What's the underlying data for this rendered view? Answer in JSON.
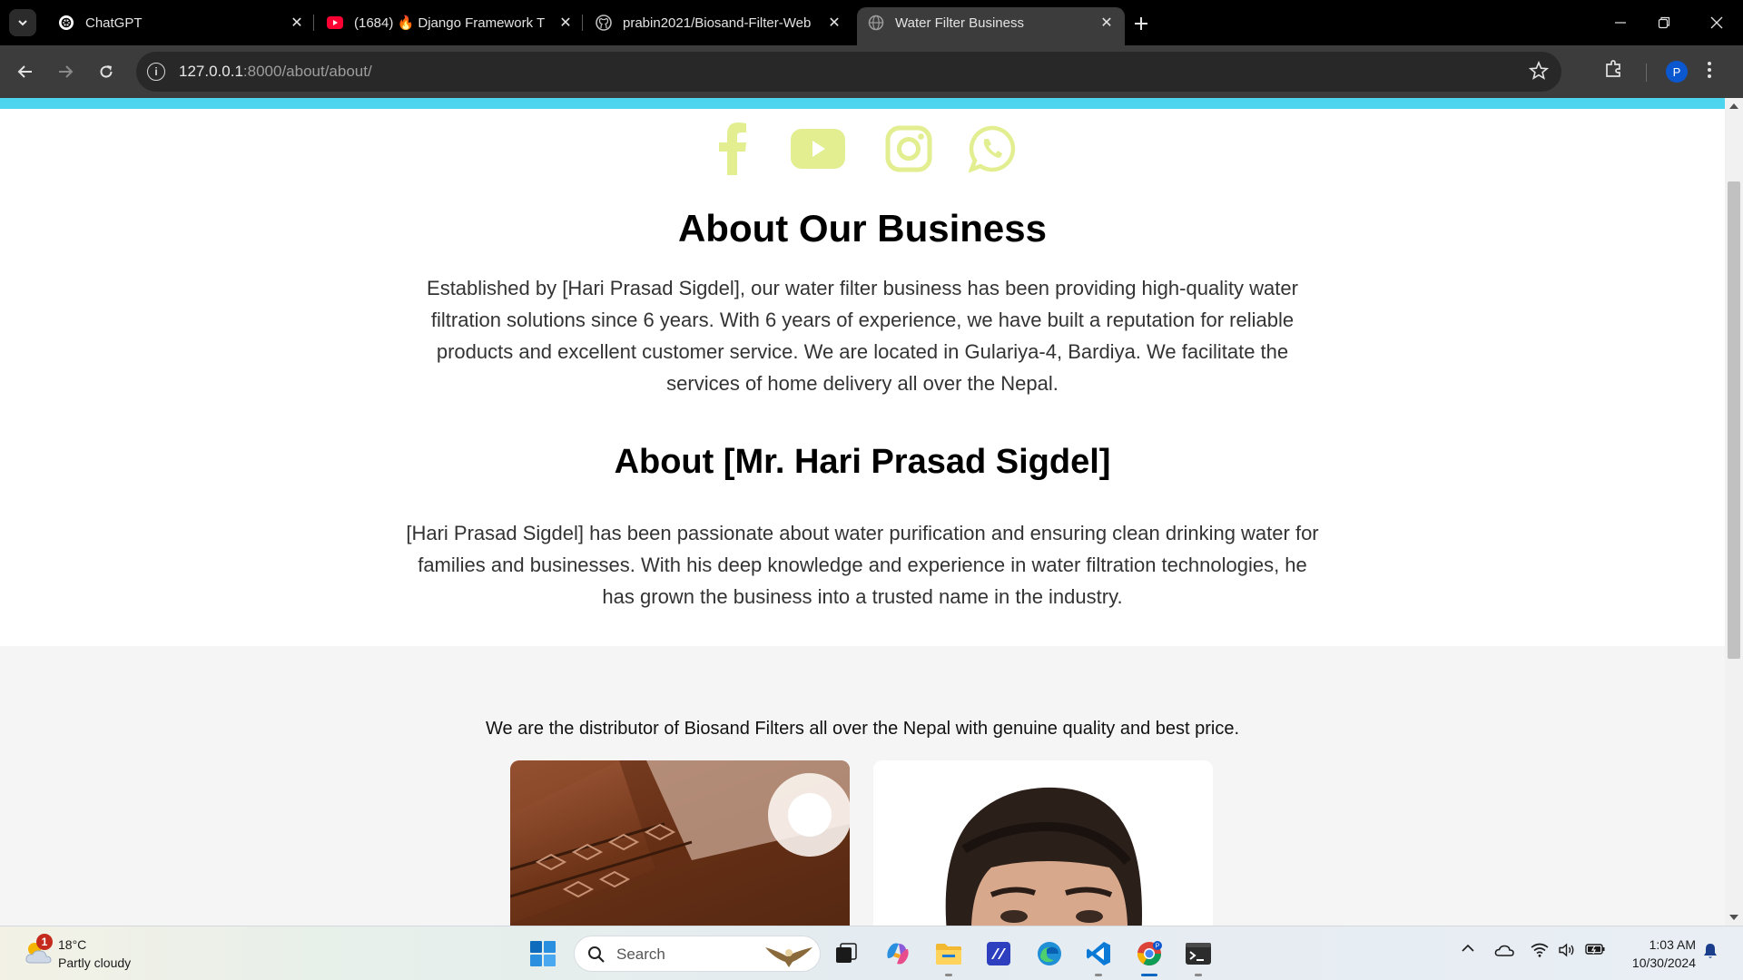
{
  "browser": {
    "tabs": [
      {
        "title": "ChatGPT",
        "icon": "chatgpt-icon",
        "active": false
      },
      {
        "title": "(1684) 🔥 Django Framework T",
        "icon": "youtube-icon",
        "active": false
      },
      {
        "title": "prabin2021/Biosand-Filter-Web",
        "icon": "github-icon",
        "active": false
      },
      {
        "title": "Water Filter Business",
        "icon": "globe-icon",
        "active": true
      }
    ],
    "url_host": "127.0.0.1",
    "url_rest": ":8000/about/about/",
    "profile_initial": "P"
  },
  "page": {
    "accent_color": "#4dd4ee",
    "social_color": "#e2ee8f",
    "social_icons": [
      "facebook-icon",
      "youtube-icon",
      "instagram-icon",
      "whatsapp-icon"
    ],
    "about_title": "About Our Business",
    "about_text": "Established by [Hari Prasad Sigdel], our water filter business has been providing high-quality water filtration solutions since 6 years. With 6 years of experience, we have built a reputation for reliable products and excellent customer service. We are located in Gulariya-4, Bardiya. We facilitate the services of home delivery all over the Nepal.",
    "owner_title": "About [Mr. Hari Prasad Sigdel]",
    "owner_text": "[Hari Prasad Sigdel] has been passionate about water purification and ensuring clean drinking water for families and businesses. With his deep knowledge and experience in water filtration technologies, he has grown the business into a trusted name in the industry.",
    "distributor_text": "We are the distributor of Biosand Filters all over the Nepal with genuine quality and best price."
  },
  "taskbar": {
    "weather_badge": "1",
    "weather_temp": "18°C",
    "weather_desc": "Partly cloudy",
    "search_label": "Search",
    "time": "1:03 AM",
    "date": "10/30/2024"
  }
}
